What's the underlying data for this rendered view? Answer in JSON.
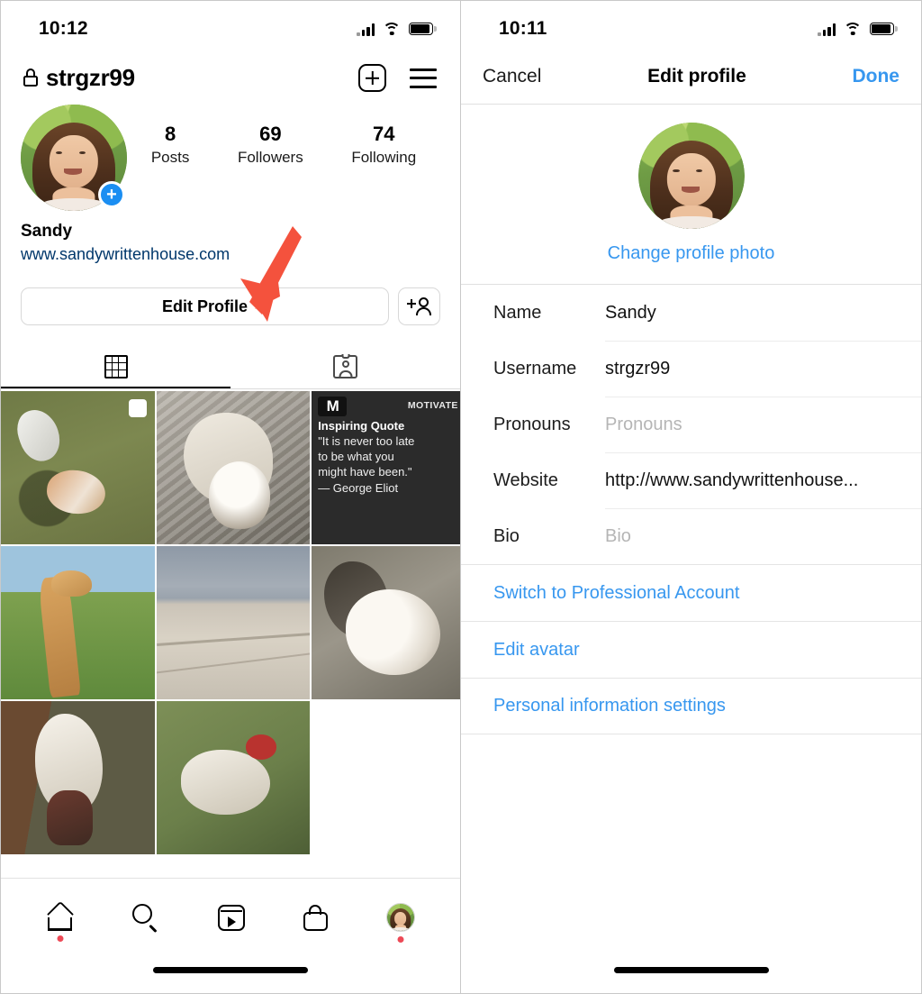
{
  "left_phone": {
    "status_bar": {
      "time": "10:12",
      "signal_icon": "cellular-signal-icon",
      "wifi_icon": "wifi-icon",
      "battery_icon": "battery-icon"
    },
    "header": {
      "lock_icon": "lock-icon",
      "username": "strgzr99",
      "new_post_icon": "plus-square-icon",
      "menu_icon": "hamburger-menu-icon"
    },
    "profile": {
      "avatar_icon": "profile-avatar",
      "add_story_badge": "+",
      "display_name": "Sandy",
      "website": "www.sandywrittenhouse.com",
      "stats": [
        {
          "num": "8",
          "label": "Posts"
        },
        {
          "num": "69",
          "label": "Followers"
        },
        {
          "num": "74",
          "label": "Following"
        }
      ],
      "edit_profile_label": "Edit Profile",
      "add_friend_icon": "person-add-icon"
    },
    "tabs": [
      {
        "name": "grid-tab",
        "icon": "grid-icon",
        "active": true
      },
      {
        "name": "tagged-tab",
        "icon": "tagged-icon",
        "active": false
      }
    ],
    "posts": [
      {
        "name": "post-dogs-on-grass",
        "style": "ph-dogs-grass",
        "multi": true
      },
      {
        "name": "post-dog-on-blanket",
        "style": "ph-dog-blanket",
        "multi": false
      },
      {
        "name": "post-inspiring-quote",
        "style": "ph-quote",
        "multi": false,
        "quote": {
          "brand_logo": "M",
          "brand_word": "MOTIVATE",
          "title": "Inspiring Quote",
          "line1": "\"It is never too late",
          "line2": "to be what you",
          "line3": "might have been.\"",
          "author": "— George Eliot"
        }
      },
      {
        "name": "post-giraffe",
        "style": "ph-giraffe",
        "multi": false
      },
      {
        "name": "post-beach",
        "style": "ph-beach",
        "multi": false
      },
      {
        "name": "post-dog-on-rock",
        "style": "ph-dog-rock",
        "multi": false
      },
      {
        "name": "post-dog-on-couch",
        "style": "ph-dog-couch",
        "multi": false
      },
      {
        "name": "post-dog-green-couch",
        "style": "ph-dog-green",
        "multi": false
      }
    ],
    "tab_bar": [
      {
        "name": "tab-home",
        "icon": "home-icon",
        "badge": true
      },
      {
        "name": "tab-search",
        "icon": "search-icon",
        "badge": false
      },
      {
        "name": "tab-reels",
        "icon": "reels-icon",
        "badge": false
      },
      {
        "name": "tab-shop",
        "icon": "shop-icon",
        "badge": false
      },
      {
        "name": "tab-profile",
        "icon": "avatar-icon",
        "badge": true
      }
    ]
  },
  "right_phone": {
    "status_bar": {
      "time": "10:11",
      "signal_icon": "cellular-signal-icon",
      "wifi_icon": "wifi-icon",
      "battery_icon": "battery-icon"
    },
    "nav_bar": {
      "cancel_label": "Cancel",
      "title": "Edit profile",
      "done_label": "Done"
    },
    "photo_section": {
      "avatar_icon": "profile-avatar",
      "change_photo_label": "Change profile photo"
    },
    "fields": [
      {
        "name": "name-field",
        "label": "Name",
        "value": "Sandy",
        "placeholder": false
      },
      {
        "name": "username-field",
        "label": "Username",
        "value": "strgzr99",
        "placeholder": false
      },
      {
        "name": "pronouns-field",
        "label": "Pronouns",
        "value": "Pronouns",
        "placeholder": true
      },
      {
        "name": "website-field",
        "label": "Website",
        "value": "http://www.sandywrittenhouse...",
        "placeholder": false
      },
      {
        "name": "bio-field",
        "label": "Bio",
        "value": "Bio",
        "placeholder": true
      }
    ],
    "links": [
      {
        "name": "switch-to-professional-account-link",
        "label": "Switch to Professional Account"
      },
      {
        "name": "edit-avatar-link",
        "label": "Edit avatar"
      },
      {
        "name": "personal-information-settings-link",
        "label": "Personal information settings"
      }
    ]
  },
  "annotations": {
    "arrow_color": "#f4523d",
    "arrows": [
      {
        "name": "arrow-pointing-to-edit-profile",
        "direction": "down"
      },
      {
        "name": "arrow-pointing-to-edit-avatar",
        "direction": "left"
      }
    ]
  },
  "colors": {
    "instagram_blue": "#3797ef",
    "link_navy": "#00376b",
    "badge_red": "#ed4956",
    "arrow_red": "#f4523d"
  }
}
